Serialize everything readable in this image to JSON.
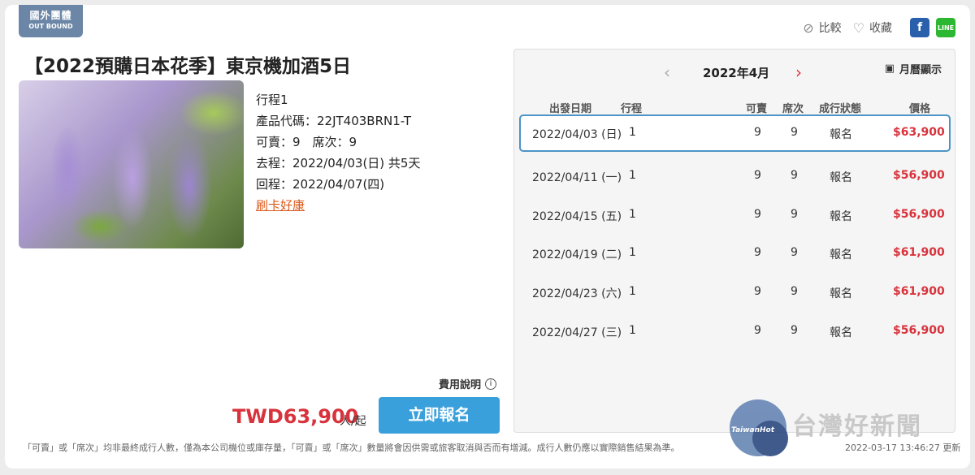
{
  "badge": {
    "zh": "國外團體",
    "en": "OUT BOUND"
  },
  "actions": {
    "compare": "比較",
    "favorite": "收藏",
    "fb": "f",
    "line": "LINE"
  },
  "title": "【2022預購日本花季】東京機加酒5日",
  "info": {
    "itinerary": "行程1",
    "code": "產品代碼：22JT403BRN1-T",
    "seats": "可賣：9　席次：9",
    "depart": "去程：2022/04/03(日)  共5天",
    "return": "回程：2022/04/07(四)",
    "promo": "刷卡好康"
  },
  "fee_label": "費用說明",
  "fee_icon": "i",
  "price": "TWD63,900",
  "price_unit": "人/起",
  "book_button": "立即報名",
  "note": "「可賣」或「席次」均非最終成行人數，僅為本公司機位或庫存量，「可賣」或「席次」數量將會因供需或旅客取消與否而有增減。成行人數仍應以實際銷售結果為準。",
  "stamp": "2022-03-17 13:46:27 更新",
  "calendar": {
    "prev": "‹",
    "next": "›",
    "month": "2022年4月",
    "toggle": "月曆顯示",
    "headers": {
      "date": "出發日期",
      "itinerary": "行程",
      "avail": "可賣",
      "seats": "席次",
      "status": "成行狀態",
      "price": "價格"
    },
    "rows": [
      {
        "date": "2022/04/03 (日)",
        "itin": "1",
        "avail": "9",
        "seats": "9",
        "status": "報名",
        "price": "$63,900"
      },
      {
        "date": "2022/04/11 (一)",
        "itin": "1",
        "avail": "9",
        "seats": "9",
        "status": "報名",
        "price": "$56,900"
      },
      {
        "date": "2022/04/15 (五)",
        "itin": "1",
        "avail": "9",
        "seats": "9",
        "status": "報名",
        "price": "$56,900"
      },
      {
        "date": "2022/04/19 (二)",
        "itin": "1",
        "avail": "9",
        "seats": "9",
        "status": "報名",
        "price": "$61,900"
      },
      {
        "date": "2022/04/23 (六)",
        "itin": "1",
        "avail": "9",
        "seats": "9",
        "status": "報名",
        "price": "$61,900"
      },
      {
        "date": "2022/04/27 (三)",
        "itin": "1",
        "avail": "9",
        "seats": "9",
        "status": "報名",
        "price": "$56,900"
      }
    ]
  },
  "watermark": {
    "logo": "TaiwanHot",
    "text": "台灣好新聞"
  }
}
